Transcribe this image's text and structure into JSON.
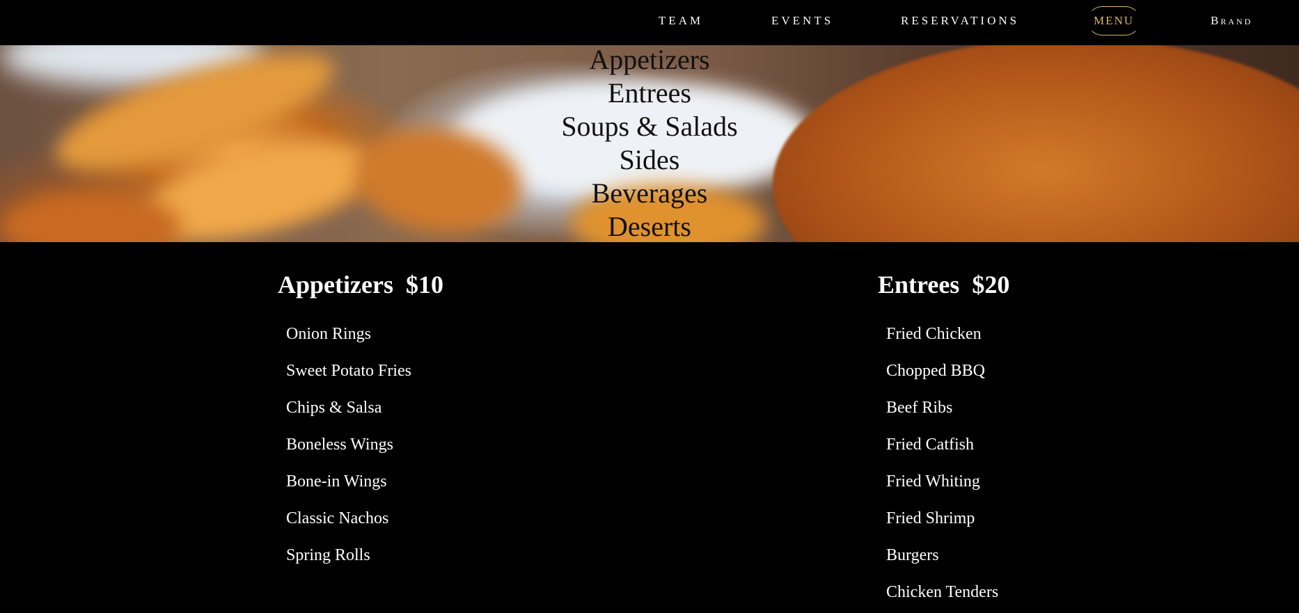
{
  "nav": {
    "items": [
      {
        "label": "TEAM"
      },
      {
        "label": "EVENTS"
      },
      {
        "label": "RESERVATIONS"
      },
      {
        "label": "MENU",
        "active": true
      },
      {
        "label": "Brand"
      }
    ],
    "accent_color": "#d8b85a"
  },
  "hero": {
    "links": [
      {
        "label": "Appetizers"
      },
      {
        "label": "Entrees"
      },
      {
        "label": "Soups & Salads"
      },
      {
        "label": "Sides"
      },
      {
        "label": "Beverages"
      },
      {
        "label": "Deserts"
      }
    ]
  },
  "sections": [
    {
      "title": "Appetizers",
      "price": "$10",
      "items": [
        "Onion Rings",
        "Sweet Potato Fries",
        "Chips & Salsa",
        "Boneless Wings",
        "Bone-in Wings",
        "Classic Nachos",
        "Spring Rolls"
      ]
    },
    {
      "title": "Entrees",
      "price": "$20",
      "items": [
        "Fried Chicken",
        "Chopped BBQ",
        "Beef Ribs",
        "Fried Catfish",
        "Fried Whiting",
        "Fried Shrimp",
        "Burgers",
        "Chicken Tenders"
      ]
    }
  ]
}
